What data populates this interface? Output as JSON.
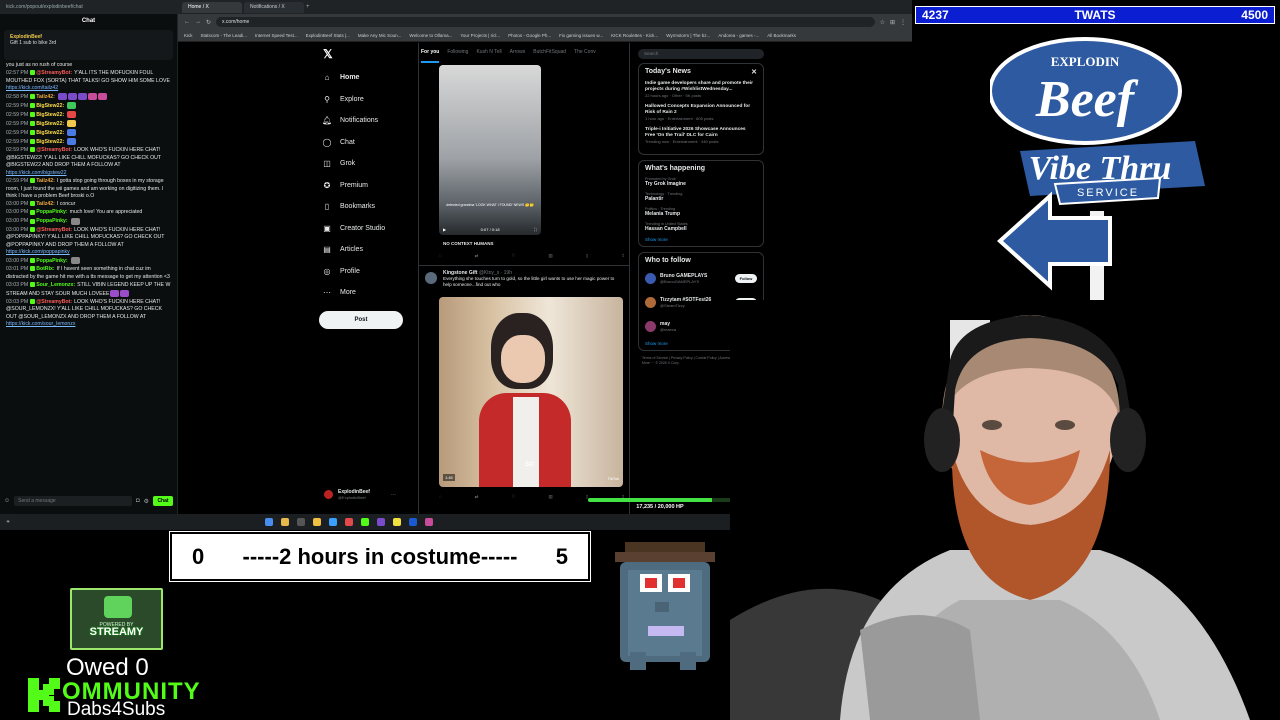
{
  "chat": {
    "window_url": "kick.com/popout/explodinbeef/chat",
    "header": "Chat",
    "pinned": {
      "name": "ExplodinBeef",
      "text": "Gift 1 sub to bike 3rd"
    },
    "messages": [
      {
        "ts": "",
        "user": "",
        "color": "#e8e8e8",
        "text": "you just as no rush of course"
      },
      {
        "ts": "02:57 PM",
        "user": "@StreamyBot:",
        "color": "#ff5a5a",
        "text": "Y'ALL ITS THE MOFUCKIN FOUL MOUTHED FOX (SORTA) THAT TALKS! GO SHOW HIM SOME LOVE",
        "link": "https://kick.com/tailz42"
      },
      {
        "ts": "02:58 PM",
        "user": "Tailz42:",
        "color": "#f2a940",
        "text": "",
        "emotes": [
          "#7b4cc9",
          "#7b4cc9",
          "#7b4cc9",
          "#c94c9a",
          "#c94c9a"
        ]
      },
      {
        "ts": "02:59 PM",
        "user": "BigStew22:",
        "color": "#ffde4a",
        "text": "",
        "emotes": [
          "#3ec95a"
        ]
      },
      {
        "ts": "02:59 PM",
        "user": "BigStew22:",
        "color": "#ffde4a",
        "text": "",
        "emotes": [
          "#e54646"
        ]
      },
      {
        "ts": "02:59 PM",
        "user": "BigStew22:",
        "color": "#ffde4a",
        "text": "",
        "emotes": [
          "#f2c94c"
        ]
      },
      {
        "ts": "02:59 PM",
        "user": "BigStew22:",
        "color": "#ffde4a",
        "text": "",
        "emotes": [
          "#4a7be5"
        ]
      },
      {
        "ts": "02:59 PM",
        "user": "BigStew22:",
        "color": "#ffde4a",
        "text": "",
        "emotes": [
          "#4a7be5"
        ]
      },
      {
        "ts": "02:59 PM",
        "user": "@StreamyBot:",
        "color": "#ff5a5a",
        "text": "LOOK WHO'S FUCKIN HERE CHAT! @BIGSTEW22! Y'ALL LIKE CHILL MOFUCKAS? GO CHECK OUT @BIGSTEW22 AND DROP THEM A FOLLOW AT",
        "link": "https://kick.com/bigstew22"
      },
      {
        "ts": "02:59 PM",
        "user": "Tailz42:",
        "color": "#f2a940",
        "text": "I gotta stop going through boxes in my storage room, I just found the wii games and am working on digitizing them. I think I have a problem Beef broski o.O"
      },
      {
        "ts": "03:00 PM",
        "user": "Tailz42:",
        "color": "#f2a940",
        "text": "I concur"
      },
      {
        "ts": "03:00 PM",
        "user": "PoppaPinky:",
        "color": "#53fc18",
        "text": "much love! You are appreciated"
      },
      {
        "ts": "03:00 PM",
        "user": "PoppaPinky:",
        "color": "#53fc18",
        "text": "",
        "emotes": [
          "#888888"
        ]
      },
      {
        "ts": "03:00 PM",
        "user": "@StreamyBot:",
        "color": "#ff5a5a",
        "text": "LOOK WHO'S FUCKIN HERE CHAT! @POPPAPINKY! Y'ALL LIKE CHILL MOFUCKAS? GO CHECK OUT @POPPAPINKY AND DROP THEM A FOLLOW AT",
        "link": "https://kick.com/poppapinky"
      },
      {
        "ts": "03:00 PM",
        "user": "PoppaPinky:",
        "color": "#53fc18",
        "text": "",
        "emotes": [
          "#888888"
        ]
      },
      {
        "ts": "03:01 PM",
        "user": "BotRix:",
        "color": "#53fc18",
        "text": "If I havent seen something in chat cuz im distracted by the game hit me with a tts message to get my attention <3"
      },
      {
        "ts": "03:03 PM",
        "user": "Sour_Lemonzx:",
        "color": "#53fc18",
        "text": "STILL VIBIN LEGEND KEEP UP THE W STREAM AND STAY SOUR MUCH LOVEEE",
        "emotes": [
          "#9b4cc9",
          "#9b4cc9"
        ]
      },
      {
        "ts": "03:03 PM",
        "user": "@StreamyBot:",
        "color": "#ff5a5a",
        "text": "LOOK WHO'S FUCKIN HERE CHAT! @SOUR_LEMONZX! Y'ALL LIKE CHILL MOFUCKAS? GO CHECK OUT @SOUR_LEMONZX AND DROP THEM A FOLLOW AT",
        "link": "https://kick.com/sour_lemonzx"
      }
    ],
    "input_placeholder": "Send a message",
    "send_label": "Chat"
  },
  "browser": {
    "tabs": [
      "Home / X",
      "Notifications / X"
    ],
    "url": "x.com/home",
    "bookmarks": [
      "Kick",
      "Statscom - The Leadi...",
      "Internet Speed Test...",
      "ExplodinBeef Stats |...",
      "Make Any Mic Soun...",
      "Welcome to Ollama...",
      "Your Projects | ricl...",
      "Photos - Google Ph...",
      "Fix gaming issues w...",
      "KICK Roulettes - Kick...",
      "Wyrmstorm | The bz...",
      "Andorea - games -...",
      "All Bookmarks"
    ]
  },
  "x": {
    "nav": [
      {
        "label": "Home",
        "icon": "home-icon",
        "glyph": "⌂"
      },
      {
        "label": "Explore",
        "icon": "search-icon",
        "glyph": "⚲"
      },
      {
        "label": "Notifications",
        "icon": "bell-icon",
        "glyph": "🔔︎"
      },
      {
        "label": "Chat",
        "icon": "chat-icon",
        "glyph": "◯"
      },
      {
        "label": "Grok",
        "icon": "grok-icon",
        "glyph": "◫"
      },
      {
        "label": "Premium",
        "icon": "premium-icon",
        "glyph": "✪"
      },
      {
        "label": "Bookmarks",
        "icon": "bookmark-icon",
        "glyph": "▯"
      },
      {
        "label": "Creator Studio",
        "icon": "creator-icon",
        "glyph": "▣"
      },
      {
        "label": "Articles",
        "icon": "articles-icon",
        "glyph": "▤"
      },
      {
        "label": "Profile",
        "icon": "profile-icon",
        "glyph": "◎"
      },
      {
        "label": "More",
        "icon": "more-icon",
        "glyph": "⋯"
      }
    ],
    "post_label": "Post",
    "account": {
      "name": "ExplodinBeef",
      "handle": "@ExplodinBeef"
    },
    "feed_tabs": [
      "For you",
      "Following",
      "Kush N Tell",
      "Arrows",
      "ButchFitSquad",
      "The Conv"
    ],
    "tweet1": {
      "video_caption": "detected grandma 'LOOK WHAT I FOUND' NEWS 🤔🤔",
      "video_time": "0:07 / 0:18",
      "source": "NO CONTEXT HUMANS"
    },
    "tweet2": {
      "name": "Kingstone Gift",
      "handle": "@Ktny_s · 19h",
      "text": "Everything she touches turn to gold, so the little girl wants to use her magic power to help someone...find out who",
      "subtitle": "SO",
      "duration": "1:45",
      "watermark": "TikTok"
    },
    "search_placeholder": "Search",
    "news": {
      "title": "Today's News",
      "items": [
        {
          "title": "Indie game developers share and promote their projects during #WishlistWednesday...",
          "meta": "22 hours ago · Other · 5K posts"
        },
        {
          "title": "Hallowed Concepts Expansion Announced for Risk of Rain 2",
          "meta": "1 hour ago · Entertainment · 805 posts"
        },
        {
          "title": "Triple-i Initiative 2026 Showcase Announces Free 'On the Trail' DLC for Cairn",
          "meta": "Trending now · Entertainment · 440 posts"
        }
      ]
    },
    "happening": {
      "title": "What's happening",
      "trends": [
        {
          "meta": "Promoted by Grok",
          "name": "Try Grok Imagine"
        },
        {
          "meta": "Technology · Trending",
          "name": "Palantir"
        },
        {
          "meta": "Politics · Trending",
          "name": "Melania Trump"
        },
        {
          "meta": "Trending in United States",
          "name": "Hassan Campbell"
        }
      ],
      "show_more": "Show more"
    },
    "follow": {
      "title": "Who to follow",
      "people": [
        {
          "name": "Bruno GAMEPLAYS",
          "handle": "@BrunoGAMEPLAYS",
          "color": "#3a5ab0"
        },
        {
          "name": "Tizzytam #SOTFest26",
          "handle": "@SteamTizzy",
          "color": "#b06a3a"
        },
        {
          "name": "may",
          "handle": "@maeca",
          "color": "#8a3a6a"
        }
      ],
      "follow_label": "Follow",
      "show_more": "Show more"
    },
    "footer": "Terms of Service | Privacy Policy | Cookie Policy | Accessibility | Ads info | More ··· © 2026 X Corp."
  },
  "hp": {
    "text": "17,235 / 20,000 HP",
    "fraction": 0.862
  },
  "goal": {
    "left": "4237",
    "title": "TWATS",
    "right": "4500"
  },
  "counter": {
    "left": "0",
    "label": "-----2 hours in costume-----",
    "right": "5"
  },
  "streamy": {
    "top": "POWERED BY",
    "name": "STREAMY"
  },
  "owed": "Owed 0",
  "kommunity": "OMMUNITY",
  "dabs": "Dabs4Subs",
  "logo": {
    "top": "EXPLODIN",
    "main": "Beef",
    "line2": "Vibe Thru",
    "service": "SERVICE"
  }
}
